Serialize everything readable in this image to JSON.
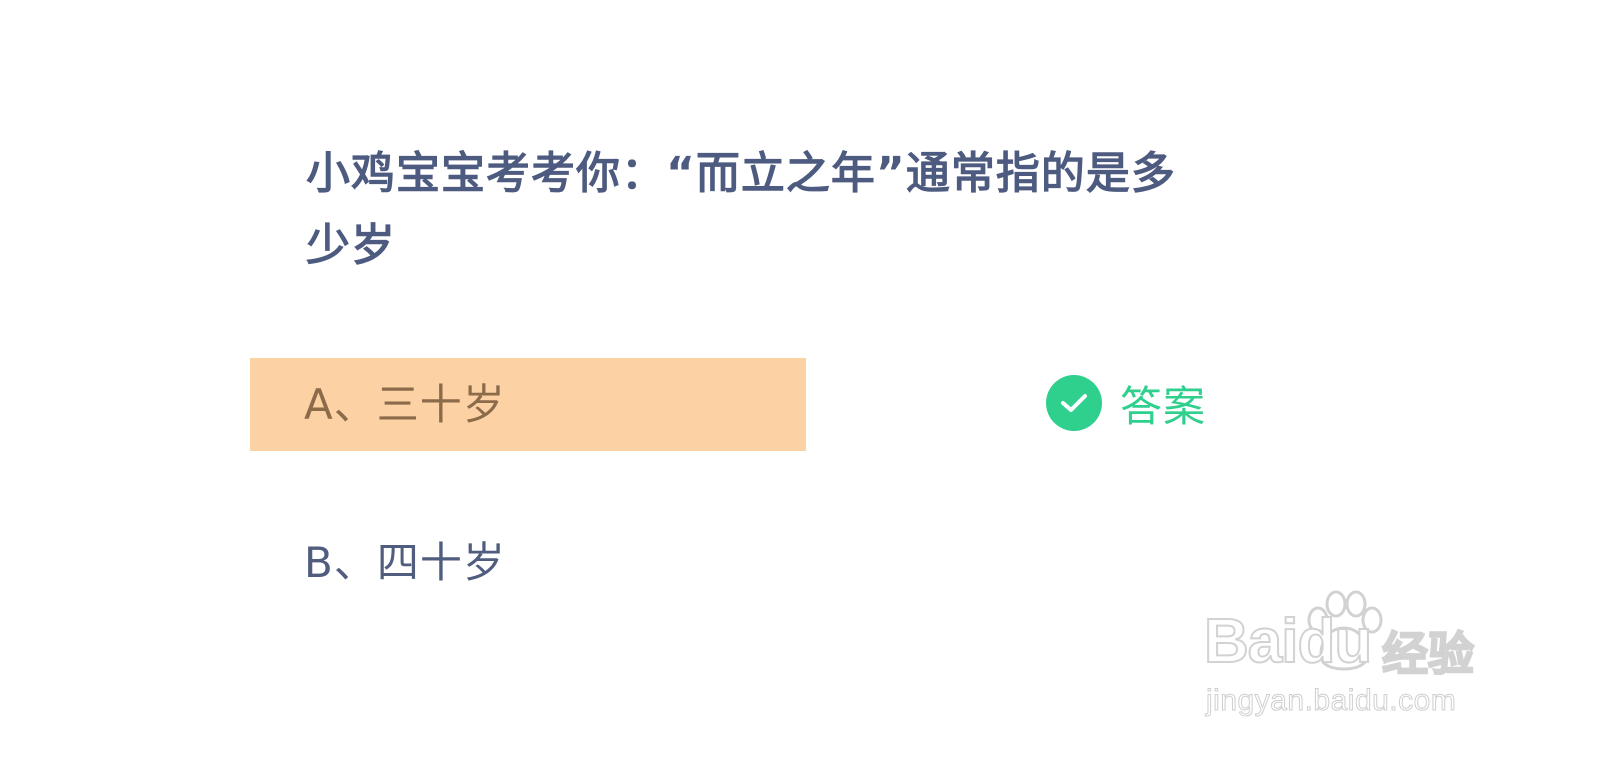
{
  "question": {
    "text": "小鸡宝宝考考你：“而立之年”通常指的是多少岁"
  },
  "options": [
    {
      "label": "A、三十岁",
      "selected": true
    },
    {
      "label": "B、四十岁",
      "selected": false
    }
  ],
  "answer": {
    "label": "答案",
    "icon": "check-circle-icon"
  },
  "watermark": {
    "brand": "Baidu",
    "suffix": "经验",
    "url": "jingyan.baidu.com"
  },
  "colors": {
    "question_text": "#4e5b80",
    "option_text": "#505d7e",
    "selected_bg": "#fcd1a4",
    "selected_text": "#8c6b4a",
    "accent_green": "#2fcf8d"
  }
}
